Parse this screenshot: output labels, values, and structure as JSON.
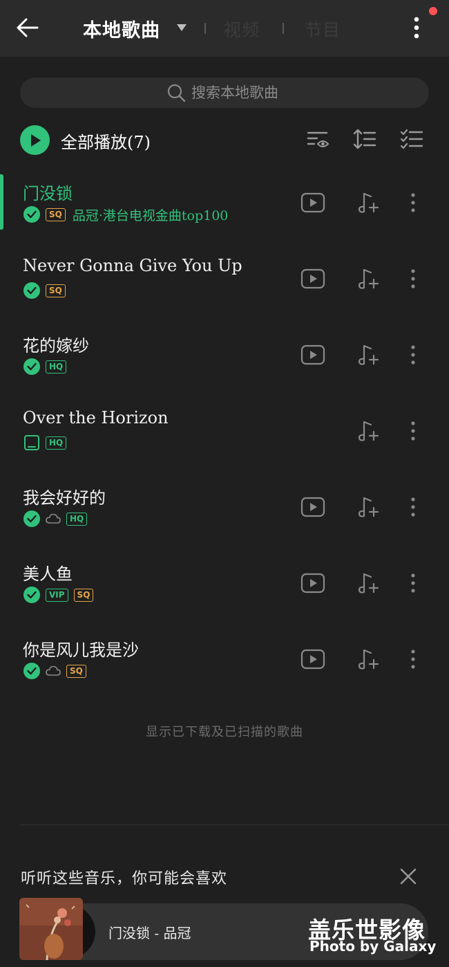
{
  "header": {
    "title": "本地歌曲",
    "tabs": [
      "视频",
      "节目"
    ]
  },
  "search": {
    "placeholder": "搜索本地歌曲"
  },
  "play_all": {
    "label": "全部播放(7)"
  },
  "songs": [
    {
      "title": "门没锁",
      "badges": [
        "check",
        "SQ"
      ],
      "album": "品冠·港台电视金曲top100",
      "has_mv": true,
      "active": true
    },
    {
      "title": "Never Gonna Give You Up",
      "badges": [
        "check",
        "SQ"
      ],
      "has_mv": true
    },
    {
      "title": "花的嫁纱",
      "badges": [
        "check",
        "HQ"
      ],
      "has_mv": true
    },
    {
      "title": "Over the Horizon",
      "badges": [
        "phone",
        "HQ"
      ],
      "has_mv": false
    },
    {
      "title": "我会好好的",
      "badges": [
        "check",
        "cloud",
        "HQ"
      ],
      "has_mv": true
    },
    {
      "title": "美人鱼",
      "badges": [
        "check",
        "VIP",
        "SQ"
      ],
      "has_mv": true
    },
    {
      "title": "你是风儿我是沙",
      "badges": [
        "check",
        "cloud",
        "SQ"
      ],
      "has_mv": true
    }
  ],
  "footer_note": "显示已下载及已扫描的歌曲",
  "recommend": {
    "title": "听听这些音乐，你可能会喜欢"
  },
  "mini_player": {
    "now_playing": "门没锁 - 品冠"
  },
  "watermark": {
    "line1": "盖乐世影像",
    "line2": "Photo by Galaxy"
  },
  "colors": {
    "accent": "#31c27c",
    "sq": "#e5a54a",
    "background": "#1f1f1f",
    "topbar": "#2b2b2b"
  },
  "icons": [
    "back-arrow-icon",
    "caret-down-icon",
    "more-vertical-icon",
    "search-icon",
    "play-icon",
    "filter-eye-icon",
    "sort-icon",
    "multi-select-icon",
    "mv-play-icon",
    "add-to-playlist-icon",
    "check-icon",
    "cloud-icon",
    "phone-icon",
    "close-icon"
  ]
}
